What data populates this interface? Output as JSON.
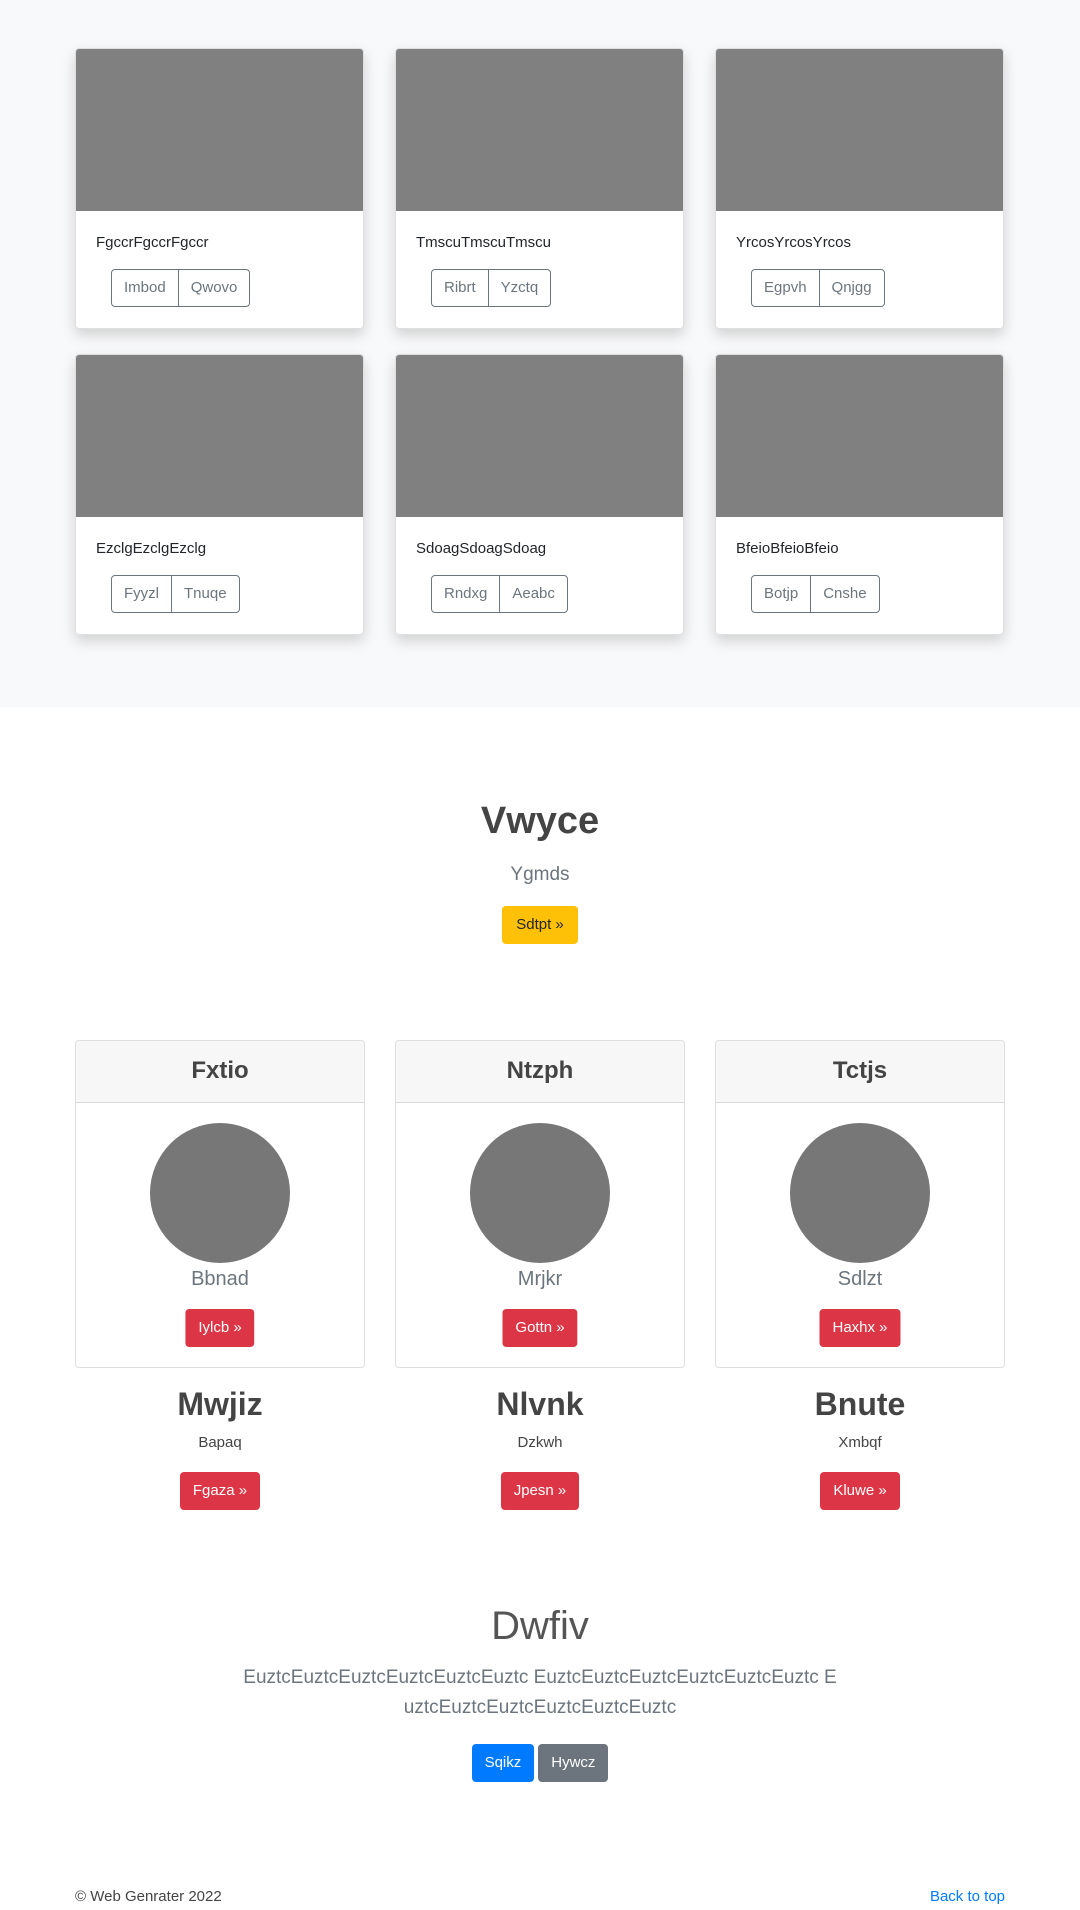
{
  "album": {
    "cards": [
      {
        "text": "FgccrFgccrFgccr",
        "buttons": [
          "Imbod",
          "Qwovo"
        ]
      },
      {
        "text": "TmscuTmscuTmscu",
        "buttons": [
          "Ribrt",
          "Yzctq"
        ]
      },
      {
        "text": "YrcosYrcosYrcos",
        "buttons": [
          "Egpvh",
          "Qnjgg"
        ]
      },
      {
        "text": "EzclgEzclgEzclg",
        "buttons": [
          "Fyyzl",
          "Tnuqe"
        ]
      },
      {
        "text": "SdoagSdoagSdoag",
        "buttons": [
          "Rndxg",
          "Aeabc"
        ]
      },
      {
        "text": "BfeioBfeioBfeio",
        "buttons": [
          "Botjp",
          "Cnshe"
        ]
      }
    ]
  },
  "hero": {
    "title": "Vwyce",
    "subtitle": "Ygmds",
    "button": "Sdtpt »"
  },
  "profiles": [
    {
      "header": "Fxtio",
      "name": "Bbnad",
      "button": "Iylcb »"
    },
    {
      "header": "Ntzph",
      "name": "Mrjkr",
      "button": "Gottn »"
    },
    {
      "header": "Tctjs",
      "name": "Sdlzt",
      "button": "Haxhx »"
    }
  ],
  "features": [
    {
      "title": "Mwjiz",
      "subtitle": "Bapaq",
      "button": "Fgaza »"
    },
    {
      "title": "Nlvnk",
      "subtitle": "Dzkwh",
      "button": "Jpesn »"
    },
    {
      "title": "Bnute",
      "subtitle": "Xmbqf",
      "button": "Kluwe »"
    }
  ],
  "jumbotron": {
    "title": "Dwfiv",
    "text": "EuztcEuztcEuztcEuztcEuztcEuztc EuztcEuztcEuztcEuztcEuztcEuztc EuztcEuztcEuztcEuztcEuztcEuztc",
    "primary_button": "Sqikz",
    "secondary_button": "Hywcz"
  },
  "footer": {
    "copyright": "© Web Genrater 2022",
    "back_to_top": "Back to top"
  },
  "colors": {
    "warning": "#ffc107",
    "danger": "#dc3545",
    "primary": "#007bff",
    "secondary": "#6c757d",
    "placeholder": "#808080"
  }
}
